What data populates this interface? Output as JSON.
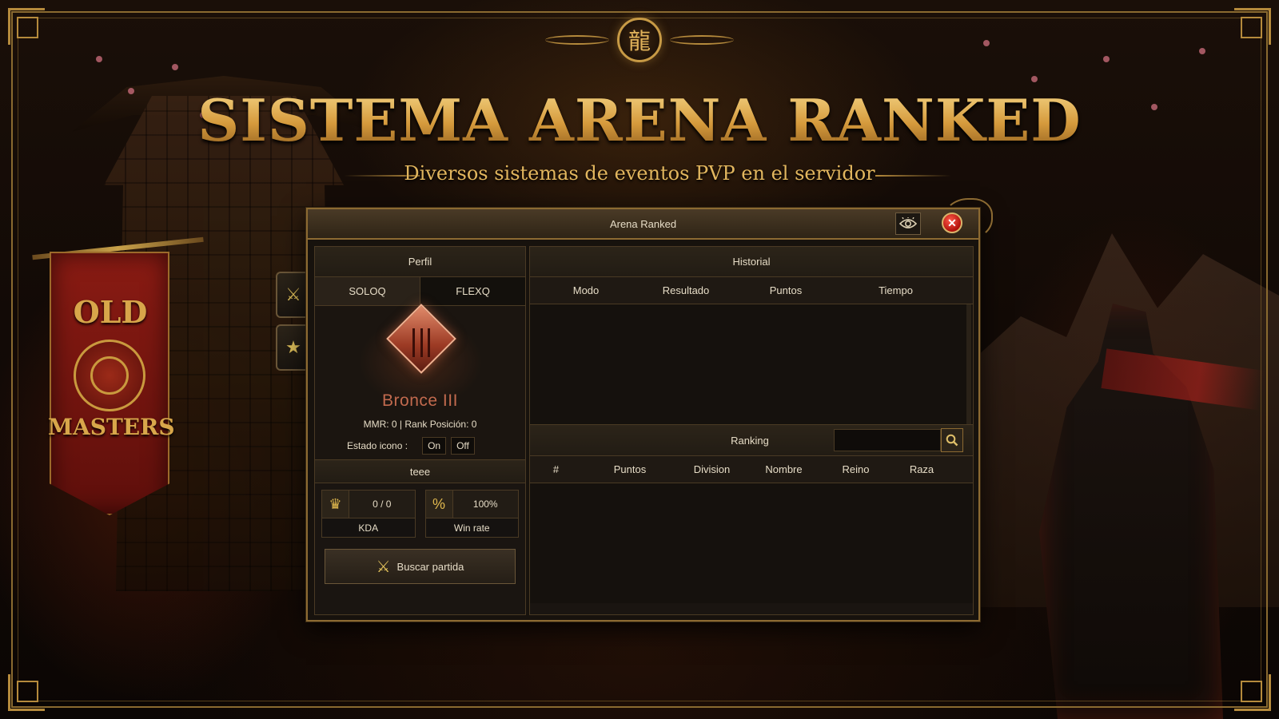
{
  "header": {
    "title": "SISTEMA ARENA RANKED",
    "subtitle": "Diversos sistemas de eventos PVP en el servidor"
  },
  "banner": {
    "line1": "OLD",
    "line2": "MASTERS"
  },
  "window": {
    "title": "Arena Ranked",
    "eye_icon": "eye-icon",
    "close_label": "✕"
  },
  "side_buttons": [
    {
      "icon": "crossed-swords-icon",
      "glyph": "⚔"
    },
    {
      "icon": "star-icon",
      "glyph": "★"
    }
  ],
  "profile": {
    "header": "Perfil",
    "tabs": [
      "SOLOQ",
      "FLEXQ"
    ],
    "active_tab": "SOLOQ",
    "rank_name": "Bronce III",
    "rank_stats": "MMR: 0 | Rank Posición: 0",
    "estado_label": "Estado icono :",
    "on_label": "On",
    "off_label": "Off",
    "player_name": "teee",
    "kda_value": "0 / 0",
    "kda_label": "KDA",
    "winrate_value": "100%",
    "winrate_label": "Win rate",
    "search_button": "Buscar partida"
  },
  "history": {
    "header": "Historial",
    "columns": [
      "Modo",
      "Resultado",
      "Puntos",
      "Tiempo"
    ],
    "rows": []
  },
  "ranking": {
    "header": "Ranking",
    "search_value": "",
    "columns": [
      "#",
      "Puntos",
      "Division",
      "Nombre",
      "Reino",
      "Raza"
    ],
    "rows": []
  },
  "colors": {
    "gold": "#d9a24a",
    "rank_bronze": "#c26a4e",
    "close_red": "#d0140c"
  }
}
